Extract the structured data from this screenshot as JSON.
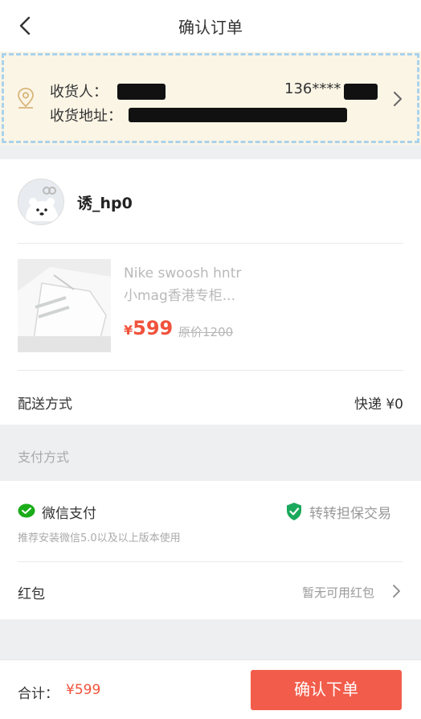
{
  "header": {
    "title": "确认订单",
    "back_icon": "back-arrow-icon"
  },
  "address": {
    "receiver_label": "收货人：",
    "phone": "136****",
    "address_label": "收货地址：",
    "chevron_icon": "chevron-right-icon",
    "pin_icon": "location-pin-icon"
  },
  "seller": {
    "name": "诱_hp0"
  },
  "product": {
    "title_line1": "Nike swoosh hntr",
    "title_line2": "小mag香港专柜...",
    "currency": "¥",
    "price": "599",
    "original_price": "原价1200"
  },
  "shipping": {
    "label": "配送方式",
    "value": "快递 ¥0"
  },
  "payment": {
    "section_title": "支付方式",
    "method": "微信支付",
    "note": "推荐安装微信5.0以及以上版本使用",
    "escrow": "转转担保交易"
  },
  "red_packet": {
    "label": "红包",
    "value": "暂无可用红包"
  },
  "footer": {
    "total_label": "合计：",
    "total_value": "¥599",
    "confirm_label": "确认下单"
  },
  "colors": {
    "accent": "#f25c4b",
    "price": "#f0523b",
    "wechat_green": "#1aad19",
    "escrow_green": "#19a85c"
  }
}
